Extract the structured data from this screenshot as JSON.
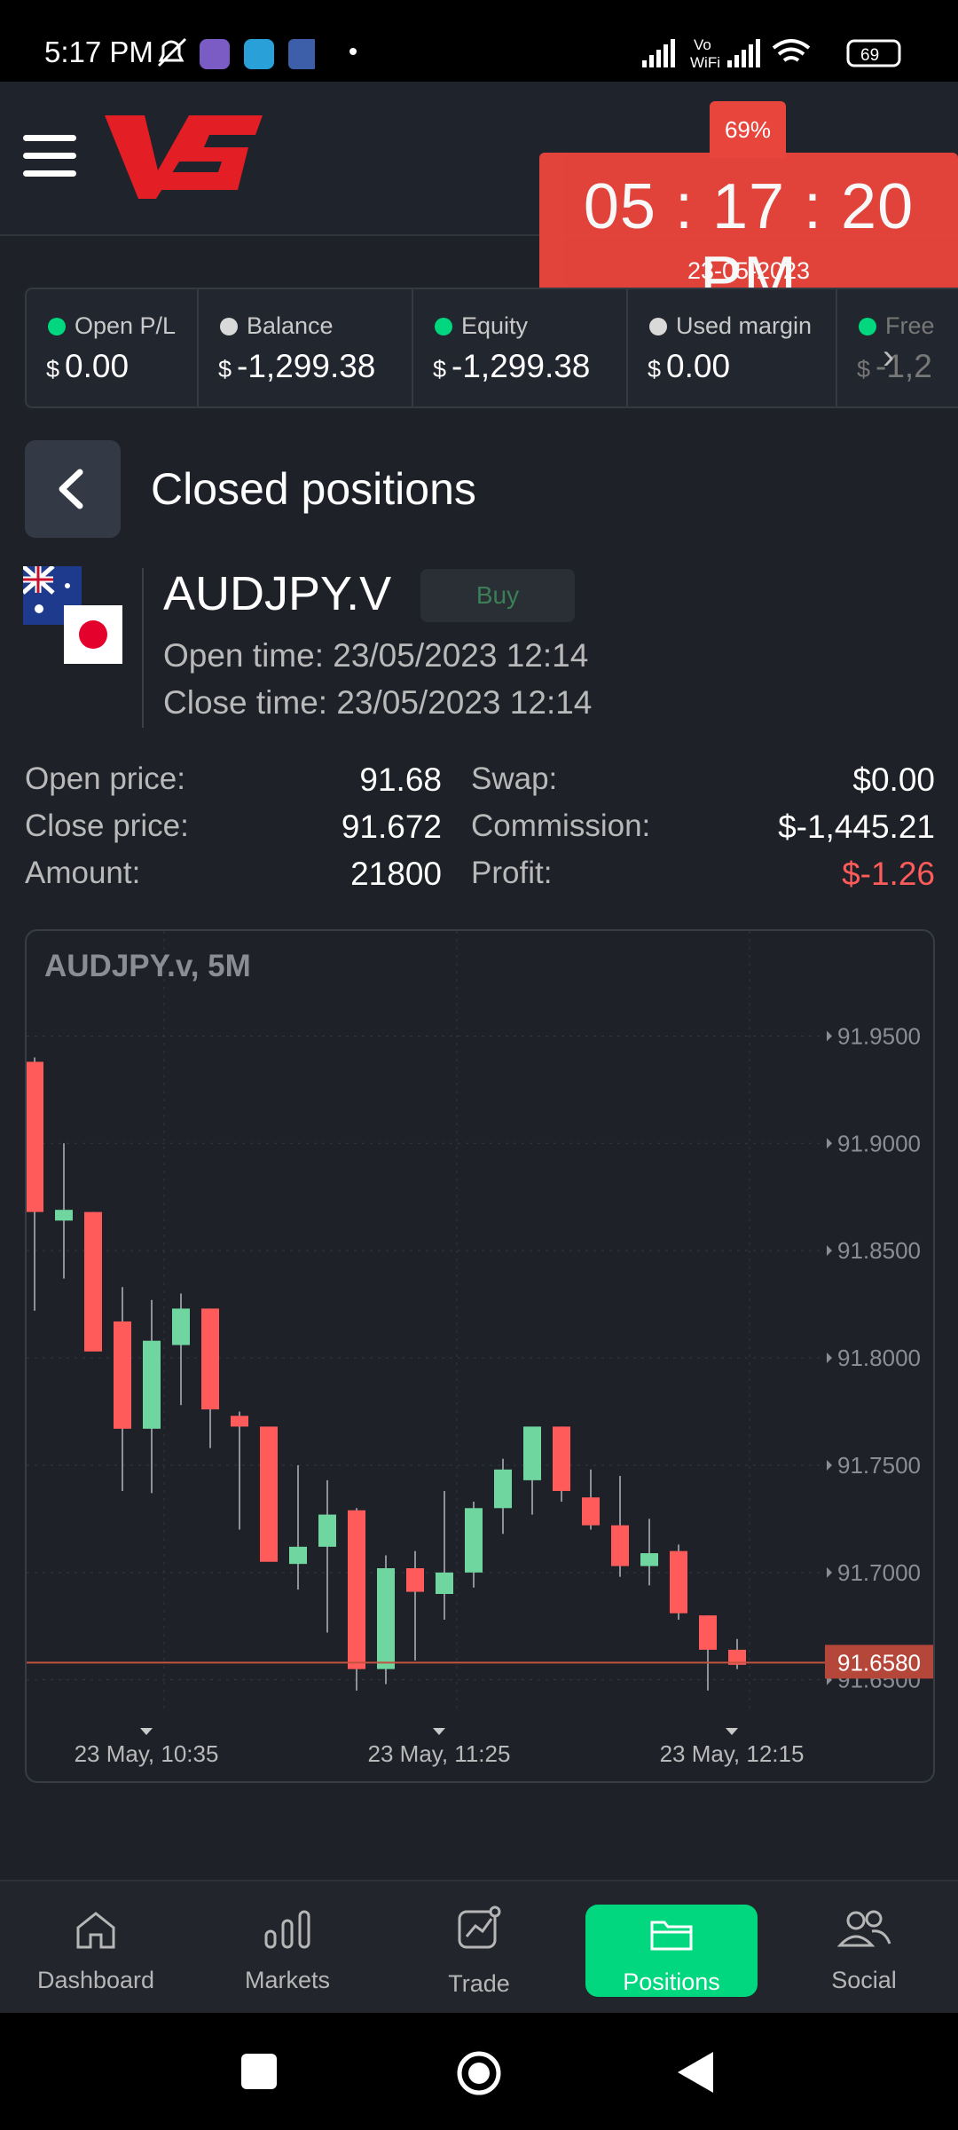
{
  "status_bar": {
    "time": "5:17 PM",
    "battery": "69",
    "network": "Vo WiFi"
  },
  "header": {
    "logo_text": "VS",
    "clock_percent": "69%",
    "clock_time": "05 : 17 : 20 PM",
    "clock_date": "23-05-2023"
  },
  "account_summary": [
    {
      "label": "Open P/L",
      "currency": "$",
      "value": "0.00",
      "dot_color": "#00d77f"
    },
    {
      "label": "Balance",
      "currency": "$",
      "value": "-1,299.38",
      "dot_color": "#d9d9d9"
    },
    {
      "label": "Equity",
      "currency": "$",
      "value": "-1,299.38",
      "dot_color": "#00d77f"
    },
    {
      "label": "Used margin",
      "currency": "$",
      "value": "0.00",
      "dot_color": "#d9d9d9"
    },
    {
      "label": "Free",
      "currency": "$",
      "value": "-1,2",
      "dot_color": "#00d77f"
    }
  ],
  "page": {
    "title": "Closed positions"
  },
  "position": {
    "symbol": "AUDJPY.V",
    "side": "Buy",
    "open_time": "Open time: 23/05/2023 12:14",
    "close_time": "Close time: 23/05/2023 12:14",
    "details_left": [
      {
        "label": "Open price:",
        "value": "91.68"
      },
      {
        "label": "Close price:",
        "value": "91.672"
      },
      {
        "label": "Amount:",
        "value": "21800"
      }
    ],
    "details_right": [
      {
        "label": "Swap:",
        "value": "$0.00"
      },
      {
        "label": "Commission:",
        "value": "$-1,445.21"
      },
      {
        "label": "Profit:",
        "value": "$-1.26"
      }
    ],
    "profit_color": "#ff5b5b"
  },
  "chart_data": {
    "type": "candlestick",
    "title": "AUDJPY.v, 5M",
    "ylim": [
      91.635,
      91.97
    ],
    "y_ticks": [
      "91.9500",
      "91.9000",
      "91.8500",
      "91.8000",
      "91.7500",
      "91.7000",
      "91.6500"
    ],
    "x_ticks": [
      "23 May, 10:35",
      "23 May, 11:25",
      "23 May, 12:15"
    ],
    "current_price": "91.6580",
    "up_color": "#6fd6a0",
    "down_color": "#ff5b5b",
    "candles": [
      {
        "open": 91.938,
        "high": 91.94,
        "low": 91.822,
        "close": 91.868
      },
      {
        "open": 91.864,
        "high": 91.9,
        "low": 91.837,
        "close": 91.869
      },
      {
        "open": 91.868,
        "high": 91.868,
        "low": 91.808,
        "close": 91.803
      },
      {
        "open": 91.817,
        "high": 91.833,
        "low": 91.738,
        "close": 91.767
      },
      {
        "open": 91.767,
        "high": 91.827,
        "low": 91.737,
        "close": 91.808
      },
      {
        "open": 91.806,
        "high": 91.83,
        "low": 91.778,
        "close": 91.823
      },
      {
        "open": 91.823,
        "high": 91.823,
        "low": 91.758,
        "close": 91.776
      },
      {
        "open": 91.773,
        "high": 91.775,
        "low": 91.72,
        "close": 91.768
      },
      {
        "open": 91.768,
        "high": 91.767,
        "low": 91.711,
        "close": 91.705
      },
      {
        "open": 91.704,
        "high": 91.75,
        "low": 91.692,
        "close": 91.712
      },
      {
        "open": 91.712,
        "high": 91.743,
        "low": 91.672,
        "close": 91.727
      },
      {
        "open": 91.729,
        "high": 91.73,
        "low": 91.645,
        "close": 91.655
      },
      {
        "open": 91.655,
        "high": 91.708,
        "low": 91.648,
        "close": 91.702
      },
      {
        "open": 91.702,
        "high": 91.71,
        "low": 91.659,
        "close": 91.691
      },
      {
        "open": 91.69,
        "high": 91.738,
        "low": 91.678,
        "close": 91.7
      },
      {
        "open": 91.7,
        "high": 91.733,
        "low": 91.693,
        "close": 91.73
      },
      {
        "open": 91.73,
        "high": 91.753,
        "low": 91.718,
        "close": 91.748
      },
      {
        "open": 91.743,
        "high": 91.768,
        "low": 91.727,
        "close": 91.768
      },
      {
        "open": 91.768,
        "high": 91.768,
        "low": 91.733,
        "close": 91.738
      },
      {
        "open": 91.735,
        "high": 91.748,
        "low": 91.72,
        "close": 91.722
      },
      {
        "open": 91.722,
        "high": 91.745,
        "low": 91.698,
        "close": 91.703
      },
      {
        "open": 91.703,
        "high": 91.725,
        "low": 91.694,
        "close": 91.709
      },
      {
        "open": 91.71,
        "high": 91.713,
        "low": 91.678,
        "close": 91.681
      },
      {
        "open": 91.68,
        "high": 91.68,
        "low": 91.645,
        "close": 91.664
      },
      {
        "open": 91.664,
        "high": 91.669,
        "low": 91.655,
        "close": 91.657
      }
    ]
  },
  "tabs": [
    {
      "label": "Dashboard",
      "icon": "home-icon"
    },
    {
      "label": "Markets",
      "icon": "bars-icon"
    },
    {
      "label": "Trade",
      "icon": "chart-icon"
    },
    {
      "label": "Positions",
      "icon": "folder-icon",
      "active": true
    },
    {
      "label": "Social",
      "icon": "users-icon"
    }
  ]
}
